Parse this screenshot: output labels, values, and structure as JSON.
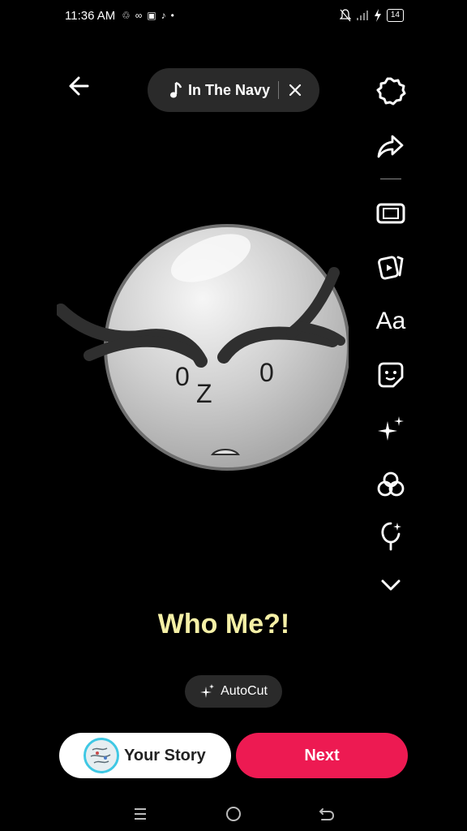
{
  "status_bar": {
    "time": "11:36 AM",
    "left_icons": [
      "sync-icon",
      "infinity-icon",
      "snapchat-icon",
      "tiktok-icon",
      "dot-icon"
    ],
    "battery": "14",
    "right_icons": [
      "mute-icon",
      "signal-icon",
      "charging-icon"
    ]
  },
  "top": {
    "back_icon": "arrow-left-icon",
    "sound": {
      "icon": "music-note-icon",
      "title": "In The Navy",
      "close_icon": "close-icon"
    }
  },
  "tools": [
    {
      "name": "settings-icon"
    },
    {
      "name": "share-icon"
    },
    {
      "name": "crop-icon"
    },
    {
      "name": "clips-icon"
    },
    {
      "name": "text-icon",
      "label": "Aa"
    },
    {
      "name": "sticker-icon"
    },
    {
      "name": "sparkle-icon"
    },
    {
      "name": "filters-icon"
    },
    {
      "name": "voiceover-icon"
    },
    {
      "name": "chevron-down-icon"
    }
  ],
  "canvas": {
    "face": {
      "left_eye": "0",
      "mouth_letter": "Z",
      "right_eye": "0"
    },
    "caption": "Who Me?!"
  },
  "autocut": {
    "label": "AutoCut",
    "icon": "sparkle-icon"
  },
  "bottom": {
    "your_story_label": "Your Story",
    "next_label": "Next"
  },
  "colors": {
    "accent": "#ed1a52",
    "caption": "#f5f0a6",
    "pill": "#2a2a2a",
    "avatar_ring": "#3fc8e4"
  }
}
